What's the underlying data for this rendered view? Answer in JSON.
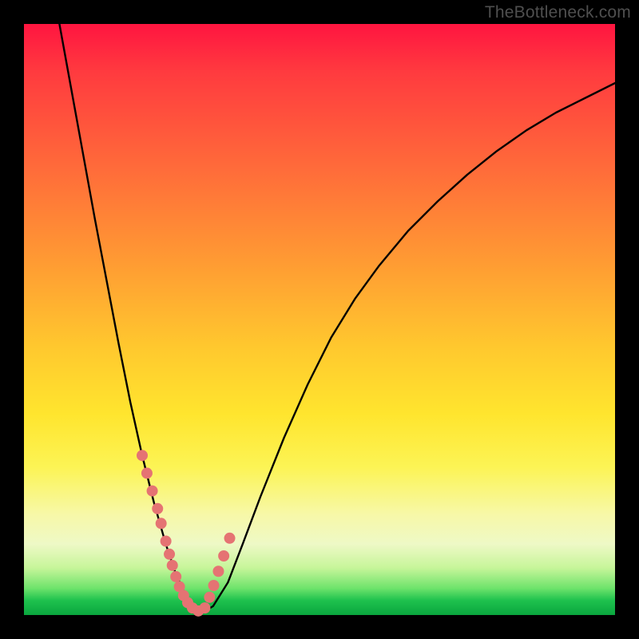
{
  "attribution": "TheBottleneck.com",
  "colors": {
    "curve_stroke": "#000000",
    "marker_fill": "#e57373",
    "background_black": "#000000"
  },
  "chart_data": {
    "type": "line",
    "title": "",
    "xlabel": "",
    "ylabel": "",
    "xlim": [
      0,
      100
    ],
    "ylim": [
      0,
      100
    ],
    "series": [
      {
        "name": "bottleneck-curve",
        "x_pct": [
          6.0,
          8.0,
          10.0,
          12.0,
          14.0,
          16.0,
          18.0,
          20.0,
          22.0,
          24.0,
          25.5,
          27.0,
          28.5,
          30.0,
          32.0,
          34.5,
          37.0,
          40.0,
          44.0,
          48.0,
          52.0,
          56.0,
          60.0,
          65.0,
          70.0,
          75.0,
          80.0,
          85.0,
          90.0,
          95.0,
          100.0
        ],
        "y_pct": [
          100.0,
          89.0,
          78.0,
          67.0,
          56.5,
          46.0,
          36.0,
          27.0,
          19.0,
          12.0,
          7.5,
          4.0,
          1.5,
          0.3,
          1.5,
          5.5,
          12.0,
          20.0,
          30.0,
          39.0,
          47.0,
          53.5,
          59.0,
          65.0,
          70.0,
          74.5,
          78.5,
          82.0,
          85.0,
          87.5,
          90.0
        ]
      }
    ],
    "markers": {
      "name": "sample-points",
      "x_pct": [
        20.0,
        20.8,
        21.7,
        22.6,
        23.2,
        24.0,
        24.6,
        25.1,
        25.7,
        26.3,
        27.0,
        27.7,
        28.5,
        29.5,
        30.6,
        31.4,
        32.1,
        32.9,
        33.8,
        34.8
      ],
      "y_pct": [
        27.0,
        24.0,
        21.0,
        18.0,
        15.5,
        12.5,
        10.3,
        8.4,
        6.5,
        4.8,
        3.3,
        2.1,
        1.2,
        0.7,
        1.2,
        3.0,
        5.0,
        7.4,
        10.0,
        13.0
      ]
    }
  }
}
